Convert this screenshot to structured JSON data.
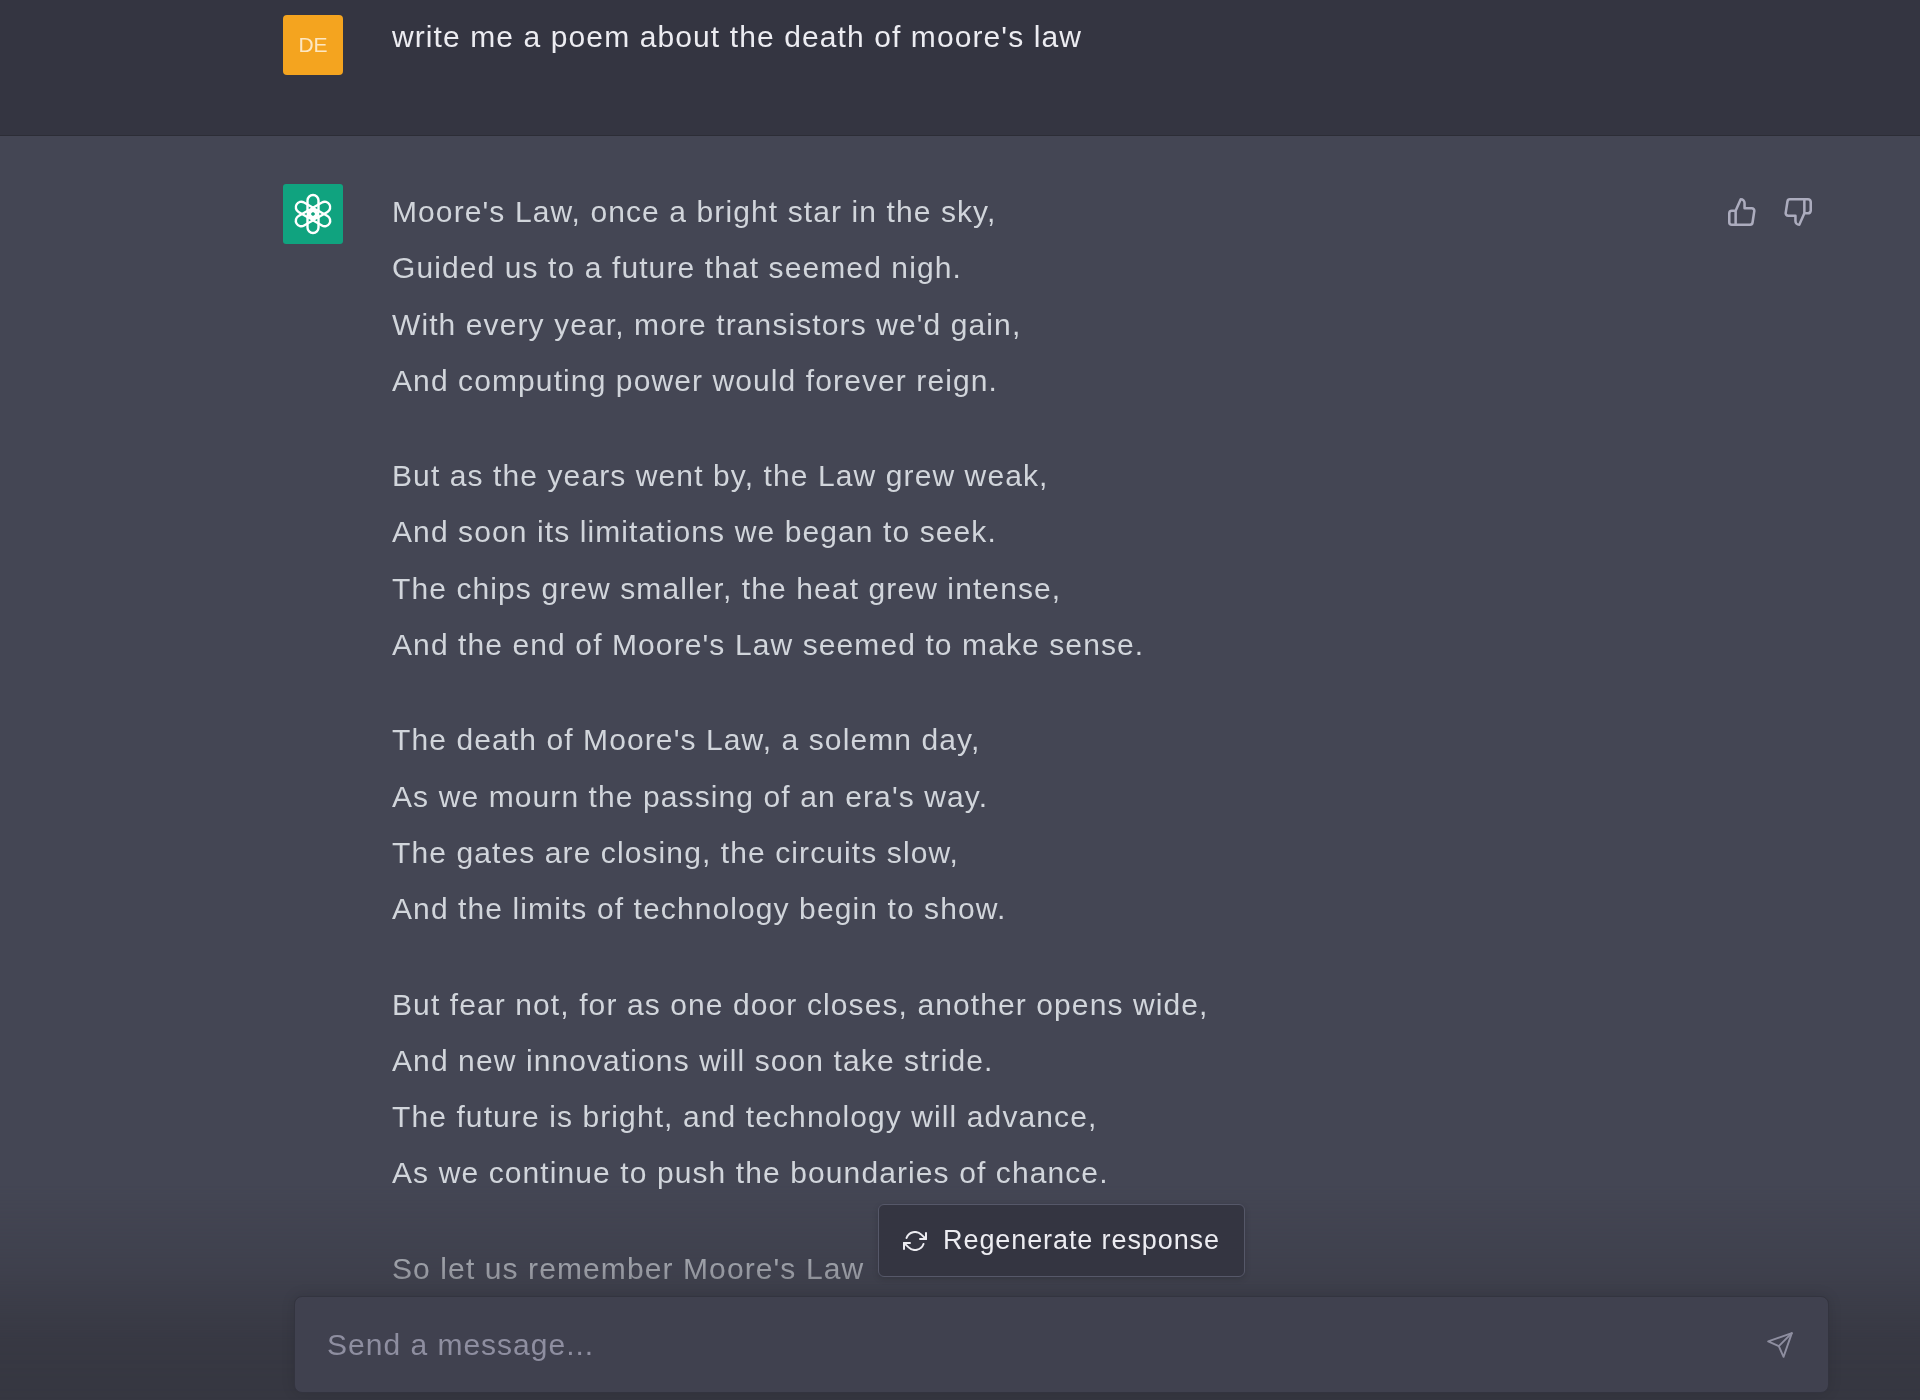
{
  "thread": [
    {
      "kind": "user",
      "avatar": "DE",
      "text": "write me a poem about the death of moore's law"
    },
    {
      "kind": "assistant",
      "stanzas": [
        [
          "Moore's Law, once a bright star in the sky,",
          "Guided us to a future that seemed nigh.",
          "With every year, more transistors we'd gain,",
          "And computing power would forever reign."
        ],
        [
          "But as the years went by, the Law grew weak,",
          "And soon its limitations we began to seek.",
          "The chips grew smaller, the heat grew intense,",
          "And the end of Moore's Law seemed to make sense."
        ],
        [
          "The death of Moore's Law, a solemn day,",
          "As we mourn the passing of an era's way.",
          "The gates are closing, the circuits slow,",
          "And the limits of technology begin to show."
        ],
        [
          "But fear not, for as one door closes, another opens wide,",
          "And new innovations will soon take stride.",
          "The future is bright, and technology will advance,",
          "As we continue to push the boundaries of chance."
        ],
        [
          "So let us remember Moore's Law"
        ]
      ]
    }
  ],
  "regenerate_button": {
    "label": "Regenerate response"
  },
  "composer": {
    "placeholder": "Send a message..."
  }
}
